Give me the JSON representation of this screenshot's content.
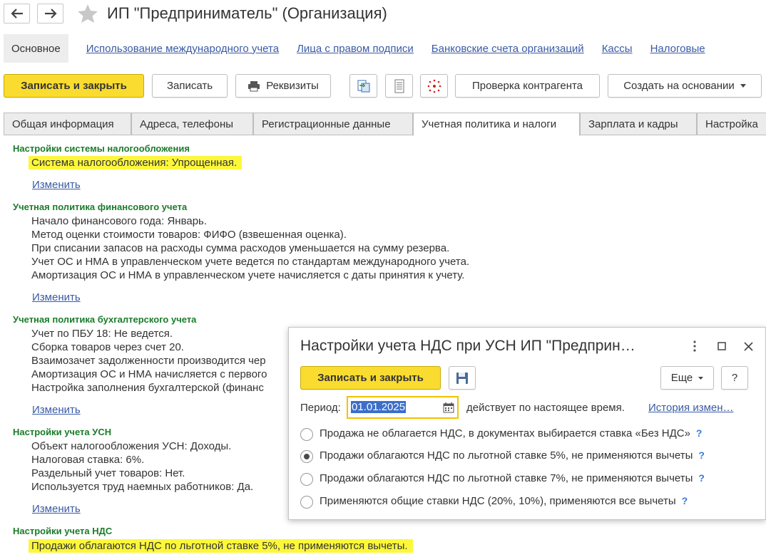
{
  "window": {
    "title": "ИП \"Предприниматель\" (Организация)"
  },
  "top_nav": {
    "active": "Основное",
    "links": [
      "Использование международного учета",
      "Лица с правом подписи",
      "Банковские счета организаций",
      "Кассы",
      "Налоговые"
    ]
  },
  "toolbar": {
    "save_close": "Записать и закрыть",
    "save": "Записать",
    "requisites": "Реквизиты",
    "check_counterparty": "Проверка контрагента",
    "create_based_on": "Создать на основании"
  },
  "tabs": [
    "Общая информация",
    "Адреса, телефоны",
    "Регистрационные данные",
    "Учетная политика и налоги",
    "Зарплата и кадры",
    "Настройка"
  ],
  "active_tab_index": 3,
  "change_link": "Изменить",
  "sections": {
    "tax_system": {
      "title": "Настройки системы налогообложения",
      "lines": [
        "Система налогообложения: Упрощенная."
      ]
    },
    "financial_policy": {
      "title": "Учетная политика финансового учета",
      "lines": [
        "Начало финансового года: Январь.",
        "Метод оценки стоимости товаров: ФИФО (взвешенная оценка).",
        "При списании запасов на расходы сумма расходов уменьшается на сумму резерва.",
        "Учет ОС и НМА в управленческом учете ведется по стандартам международного учета.",
        "Амортизация ОС и НМА в управленческом учете начисляется с даты принятия к учету."
      ]
    },
    "accounting_policy": {
      "title": "Учетная политика бухгалтерского учета",
      "lines": [
        "Учет по ПБУ 18: Не ведется.",
        "Сборка товаров через счет 20.",
        "Взаимозачет задолженности производится чер",
        "Амортизация ОС и НМА начисляется с первого",
        "Настройка заполнения бухгалтерской (финанс"
      ]
    },
    "usn": {
      "title": "Настройки учета УСН",
      "lines": [
        "Объект налогообложения УСН: Доходы.",
        "Налоговая ставка: 6%.",
        "Раздельный учет товаров: Нет.",
        "Используется труд наемных работников: Да."
      ]
    },
    "vat": {
      "title": "Настройки учета НДС",
      "lines": [
        "Продажи облагаются НДС по льготной ставке 5%, не применяются вычеты."
      ]
    }
  },
  "dialog": {
    "title": "Настройки учета НДС при УСН ИП \"Предприн…",
    "save_close": "Записать и закрыть",
    "more": "Еще",
    "help": "?",
    "period_label": "Период:",
    "period_value": "01.01.2025",
    "period_note": "действует по настоящее время.",
    "history_link": "История измен…",
    "options": [
      {
        "label": "Продажа не облагается НДС, в документах выбирается ставка «Без НДС»",
        "selected": false
      },
      {
        "label": "Продажи облагаются НДС по льготной ставке 5%, не применяются вычеты",
        "selected": true
      },
      {
        "label": "Продажи облагаются НДС по льготной ставке 7%, не применяются вычеты",
        "selected": false
      },
      {
        "label": "Применяются общие ставки НДС (20%, 10%), применяются все вычеты",
        "selected": false
      }
    ],
    "option_help": "?"
  },
  "colors": {
    "accent_yellow": "#f9dc2f",
    "highlight": "#fdf73a",
    "link": "#3a5aa5",
    "section_title": "#1a7c2a"
  }
}
